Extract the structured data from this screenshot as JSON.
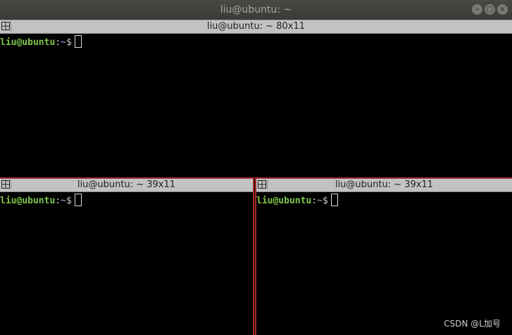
{
  "window": {
    "title": "liu@ubuntu: ~"
  },
  "panes": [
    {
      "title": "liu@ubuntu: ~ 80x11",
      "prompt": {
        "user_host": "liu@ubuntu",
        "sep": ":",
        "path": "~",
        "symbol": "$"
      }
    },
    {
      "title": "liu@ubuntu: ~ 39x11",
      "prompt": {
        "user_host": "liu@ubuntu",
        "sep": ":",
        "path": "~",
        "symbol": "$"
      }
    },
    {
      "title": "liu@ubuntu: ~ 39x11",
      "prompt": {
        "user_host": "liu@ubuntu",
        "sep": ":",
        "path": "~",
        "symbol": "$"
      }
    }
  ],
  "watermark": "CSDN @L加号",
  "colors": {
    "prompt_user": "#7fc44c",
    "prompt_path": "#7a8fc0",
    "active_border": "#a82a2a"
  }
}
